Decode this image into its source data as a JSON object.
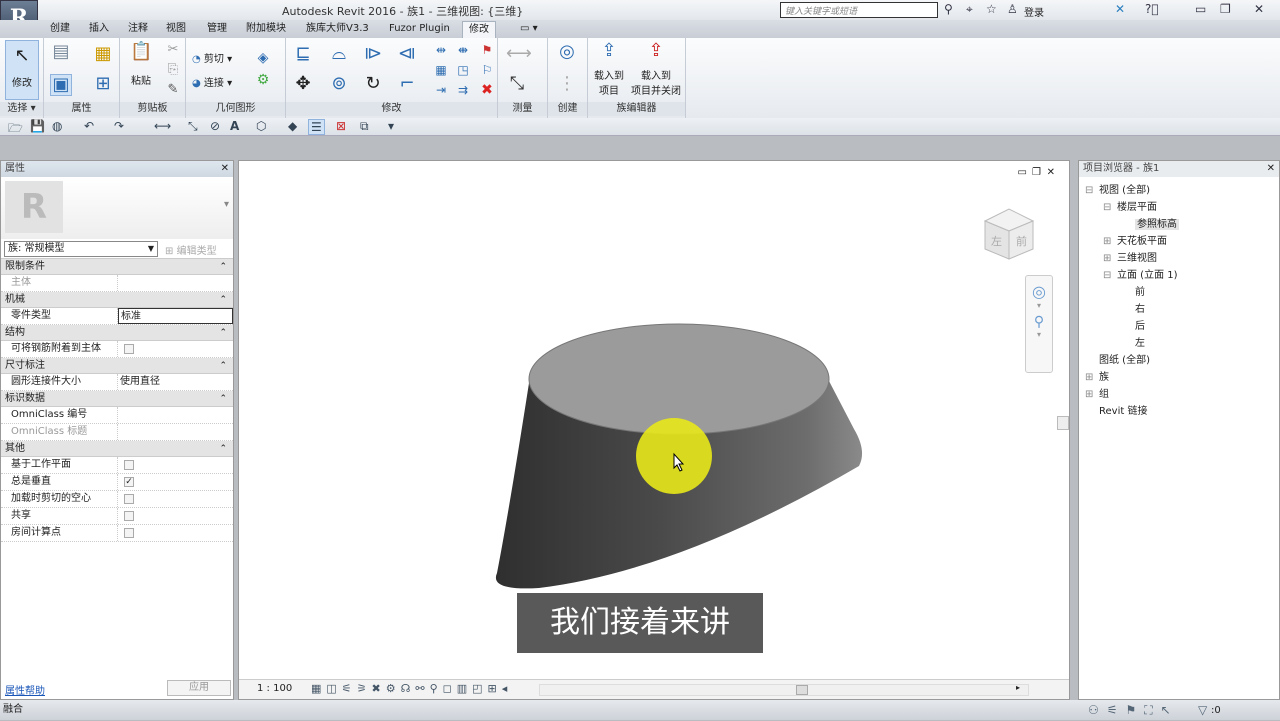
{
  "titlebar": {
    "app_logo": "R",
    "title": "Autodesk Revit 2016 -    族1 - 三维视图: {三维}",
    "search_placeholder": "键入关键字或短语",
    "login": "登录",
    "icons": [
      "binoculars-icon",
      "satellite-icon",
      "star-icon",
      "user-icon",
      "exchange-icon",
      "help-icon",
      "minimize-icon",
      "restore-icon",
      "close-icon"
    ]
  },
  "tabs": [
    "创建",
    "插入",
    "注释",
    "视图",
    "管理",
    "附加模块",
    "族库大师V3.3",
    "Fuzor Plugin",
    "修改",
    "▭ ▾"
  ],
  "active_tab": "修改",
  "ribbon": {
    "panels": [
      {
        "label": "选择 ▾"
      },
      {
        "label": "属性"
      },
      {
        "label": "剪贴板"
      },
      {
        "label": "几何图形"
      },
      {
        "label": "修改"
      },
      {
        "label": "测量"
      },
      {
        "label": "创建"
      },
      {
        "label": "族编辑器"
      }
    ],
    "modify_btn": "修改",
    "paste_btn": "粘贴",
    "cut_geom": "剪切 ▾",
    "join": "连接 ▾",
    "load_into_project": "载入到\n项目",
    "load_into_project_l1": "载入到",
    "load_into_project_l2": "项目",
    "load_close_l1": "载入到",
    "load_close_l2": "项目并关闭"
  },
  "properties": {
    "header": "属性",
    "type_selector": "族: 常规模型",
    "edit_type": "编辑类型",
    "groups": [
      {
        "name": "限制条件",
        "rows": [
          {
            "k": "主体",
            "v": "",
            "dim": true
          }
        ]
      },
      {
        "name": "机械",
        "rows": [
          {
            "k": "零件类型",
            "v": "标准",
            "edit": true
          }
        ]
      },
      {
        "name": "结构",
        "rows": [
          {
            "k": "可将钢筋附着到主体",
            "check": false
          }
        ]
      },
      {
        "name": "尺寸标注",
        "rows": [
          {
            "k": "圆形连接件大小",
            "v": "使用直径"
          }
        ]
      },
      {
        "name": "标识数据",
        "rows": [
          {
            "k": "OmniClass 编号",
            "v": ""
          },
          {
            "k": "OmniClass 标题",
            "v": "",
            "dim": true
          }
        ]
      },
      {
        "name": "其他",
        "rows": [
          {
            "k": "基于工作平面",
            "check": false
          },
          {
            "k": "总是垂直",
            "check": true
          },
          {
            "k": "加载时剪切的空心",
            "check": false
          },
          {
            "k": "共享",
            "check": false
          },
          {
            "k": "房间计算点",
            "check": false
          }
        ]
      }
    ],
    "help_link": "属性帮助",
    "apply_btn": "应用"
  },
  "view": {
    "scale": "1 : 100",
    "viewcube_left": "左",
    "viewcube_front": "前",
    "cursor_highlight_color": "#e8e81a",
    "shape_top_color": "#9a9a9a",
    "shape_side_color": "#3a3a3a"
  },
  "browser": {
    "header": "项目浏览器 - 族1",
    "items": [
      {
        "label": "视图 (全部)",
        "toggle": "⊟",
        "level": 0
      },
      {
        "label": "楼层平面",
        "toggle": "⊟",
        "level": 1
      },
      {
        "label": "参照标高",
        "toggle": "",
        "level": 2,
        "selected": true
      },
      {
        "label": "天花板平面",
        "toggle": "⊞",
        "level": 1
      },
      {
        "label": "三维视图",
        "toggle": "⊞",
        "level": 1
      },
      {
        "label": "立面 (立面 1)",
        "toggle": "⊟",
        "level": 1
      },
      {
        "label": "前",
        "toggle": "",
        "level": 2
      },
      {
        "label": "右",
        "toggle": "",
        "level": 2
      },
      {
        "label": "后",
        "toggle": "",
        "level": 2
      },
      {
        "label": "左",
        "toggle": "",
        "level": 2
      },
      {
        "label": "图纸 (全部)",
        "toggle": "",
        "level": 0
      },
      {
        "label": "族",
        "toggle": "⊞",
        "level": 0
      },
      {
        "label": "组",
        "toggle": "⊞",
        "level": 0
      },
      {
        "label": "Revit 链接",
        "toggle": "",
        "level": 0
      }
    ]
  },
  "status": {
    "text": "融合",
    "filter_count": ":0"
  },
  "subtitle": "我们接着来讲"
}
